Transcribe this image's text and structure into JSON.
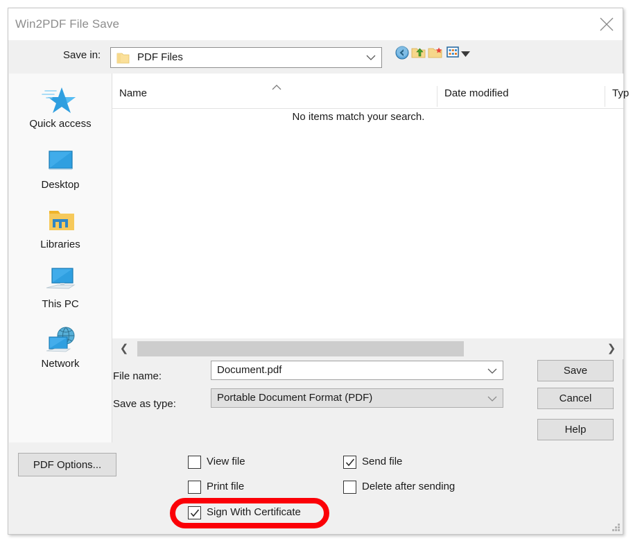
{
  "window": {
    "title": "Win2PDF File Save",
    "close_label": "Close"
  },
  "toolbar": {
    "save_in_label": "Save in:",
    "current_folder": "PDF Files",
    "buttons": [
      {
        "name": "back-button",
        "tooltip": "Back"
      },
      {
        "name": "up-one-level-button",
        "tooltip": "Up one level"
      },
      {
        "name": "new-folder-button",
        "tooltip": "Create New Folder"
      },
      {
        "name": "views-button",
        "tooltip": "Views"
      }
    ]
  },
  "sidebar": {
    "items": [
      {
        "label": "Quick access",
        "icon": "star-icon"
      },
      {
        "label": "Desktop",
        "icon": "monitor-icon"
      },
      {
        "label": "Libraries",
        "icon": "folder-library-icon"
      },
      {
        "label": "This PC",
        "icon": "computer-icon"
      },
      {
        "label": "Network",
        "icon": "network-globe-icon"
      }
    ]
  },
  "file_list": {
    "columns": [
      {
        "label": "Name",
        "sorted": "ascending"
      },
      {
        "label": "Date modified",
        "sorted": ""
      },
      {
        "label": "Typ",
        "sorted": ""
      }
    ],
    "empty_message": "No items match your search.",
    "rows": []
  },
  "form": {
    "file_name_label": "File name:",
    "file_name_value": "Document.pdf",
    "save_as_type_label": "Save as type:",
    "save_as_type_value": "Portable Document Format (PDF)"
  },
  "buttons": {
    "save": "Save",
    "cancel": "Cancel",
    "help": "Help",
    "pdf_options": "PDF Options..."
  },
  "options": {
    "view_file": {
      "label": "View file",
      "checked": false
    },
    "print_file": {
      "label": "Print file",
      "checked": false
    },
    "sign_with_certificate": {
      "label": "Sign With Certificate",
      "checked": true
    },
    "send_file": {
      "label": "Send file",
      "checked": true
    },
    "delete_after_sending": {
      "label": "Delete after sending",
      "checked": false
    }
  },
  "annotation": {
    "highlight_color": "#fb0007",
    "highlight_target": "sign-with-certificate-checkbox"
  }
}
